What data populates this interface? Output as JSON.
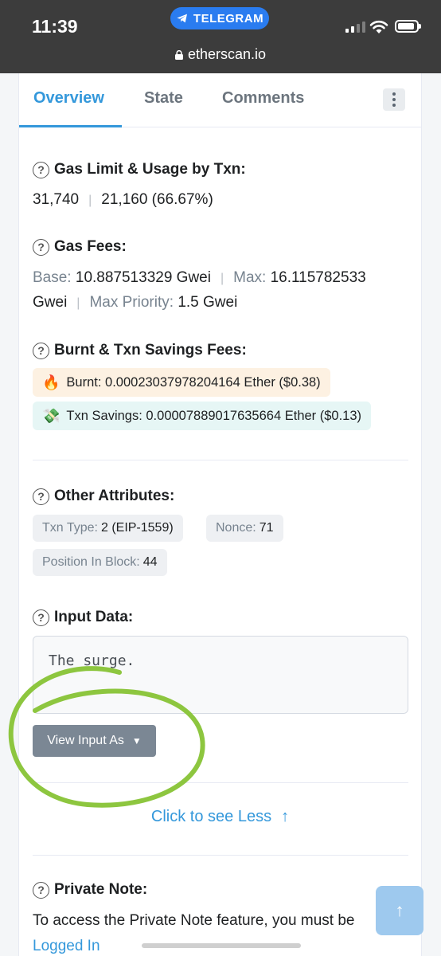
{
  "status_bar": {
    "time": "11:39",
    "return_app": "TELEGRAM",
    "url": "etherscan.io"
  },
  "tabs": [
    {
      "label": "Overview",
      "active": true
    },
    {
      "label": "State",
      "active": false
    },
    {
      "label": "Comments",
      "active": false
    }
  ],
  "gas_limit": {
    "title": "Gas Limit & Usage by Txn:",
    "limit": "31,740",
    "usage": "21,160 (66.67%)"
  },
  "gas_fees": {
    "title": "Gas Fees:",
    "base_label": "Base:",
    "base_value": "10.887513329 Gwei",
    "max_label": "Max:",
    "max_value": "16.115782533",
    "max_unit": "Gwei",
    "priority_label": "Max Priority:",
    "priority_value": "1.5 Gwei"
  },
  "burnt": {
    "title": "Burnt & Txn Savings Fees:",
    "burnt_text": "Burnt: 0.00023037978204164 Ether ($0.38)",
    "savings_text": "Txn Savings: 0.00007889017635664 Ether ($0.13)"
  },
  "other": {
    "title": "Other Attributes:",
    "txn_type_label": "Txn Type:",
    "txn_type_value": "2 (EIP-1559)",
    "nonce_label": "Nonce:",
    "nonce_value": "71",
    "position_label": "Position In Block:",
    "position_value": "44"
  },
  "input_data": {
    "title": "Input Data:",
    "value": "The surge.",
    "view_button": "View Input As"
  },
  "see_less": "Click to see Less",
  "private_note": {
    "title": "Private Note:",
    "text": "To access the Private Note feature, you must be",
    "link": "Logged In"
  },
  "colors": {
    "accent": "#3498db",
    "annotation": "#8dc63f"
  }
}
